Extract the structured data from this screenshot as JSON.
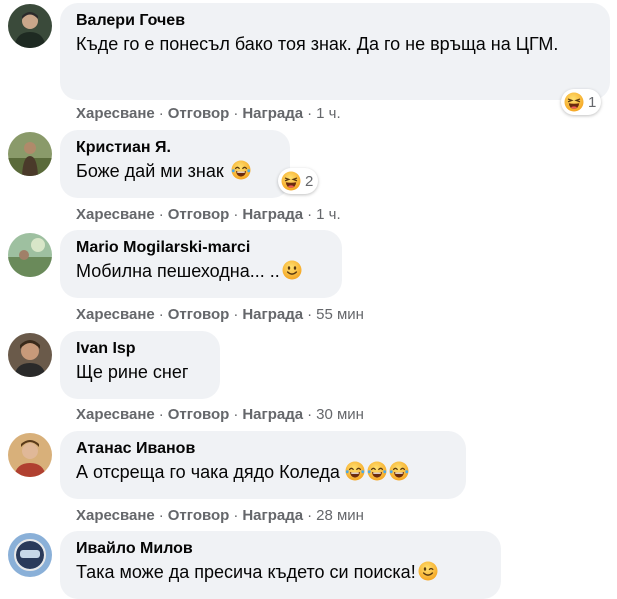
{
  "actions": {
    "like": "Харесване",
    "reply": "Отговор",
    "award": "Награда"
  },
  "comments": [
    {
      "author": "Валери Гочев",
      "text": "Къде го е понесъл бако тоя знак. Да го не връща на ЦГМ.",
      "reaction": {
        "icon": "laughing-emoji",
        "count": "1"
      },
      "time": "1 ч."
    },
    {
      "author": "Кристиан Я.",
      "text": "Боже дай ми знак",
      "inline_emoji": [
        "tears-of-joy-emoji"
      ],
      "reaction": {
        "icon": "laughing-emoji",
        "count": "2"
      },
      "time": "1 ч."
    },
    {
      "author": "Mario Mogilarski-marci",
      "text": "Мобилна пешеходна... ..",
      "inline_emoji": [
        "smiling-emoji"
      ],
      "time": "55 мин"
    },
    {
      "author": "Ivan Isp",
      "text": "Ще рине снег",
      "time": "30 мин"
    },
    {
      "author": "Атанас Иванов",
      "text": "А отсреща го чака дядо Коледа",
      "inline_emoji": [
        "tears-of-joy-emoji",
        "tears-of-joy-emoji",
        "tears-of-joy-emoji"
      ],
      "time": "28 мин"
    },
    {
      "author": "Ивайло Милов",
      "text": "Така може да пресича където си поиска!",
      "inline_emoji": [
        "winking-emoji"
      ]
    }
  ],
  "colors": {
    "bubble": "#f0f2f5",
    "secondary_text": "#65676b",
    "emoji_yellow": "#fbcb3a"
  }
}
